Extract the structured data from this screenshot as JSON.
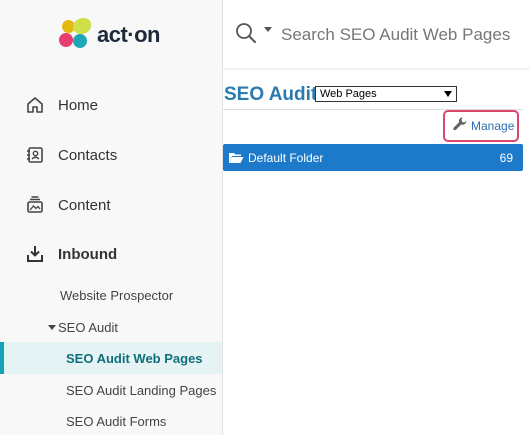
{
  "brand": {
    "name": "act·on"
  },
  "sidebar": {
    "items": [
      {
        "label": "Home",
        "icon": "home-icon"
      },
      {
        "label": "Contacts",
        "icon": "contacts-icon"
      },
      {
        "label": "Content",
        "icon": "content-icon"
      },
      {
        "label": "Inbound",
        "icon": "inbound-icon"
      }
    ],
    "subitems": [
      {
        "label": "Website Prospector"
      },
      {
        "label": "SEO Audit",
        "expanded": true
      },
      {
        "label": "SEO Audit Web Pages",
        "active": true
      },
      {
        "label": "SEO Audit Landing Pages"
      },
      {
        "label": "SEO Audit Forms"
      }
    ]
  },
  "search": {
    "placeholder": "Search SEO Audit Web Pages"
  },
  "main": {
    "title": "SEO Audit",
    "select": {
      "selected": "Web Pages"
    },
    "manage_label": "Manage",
    "folders": [
      {
        "name": "Default Folder",
        "count": "69"
      }
    ]
  },
  "colors": {
    "accent": "#2a7ab0",
    "folder_row": "#1d79c9",
    "active_indicator": "#16a3b5",
    "manage_highlight": "#d9486a"
  }
}
